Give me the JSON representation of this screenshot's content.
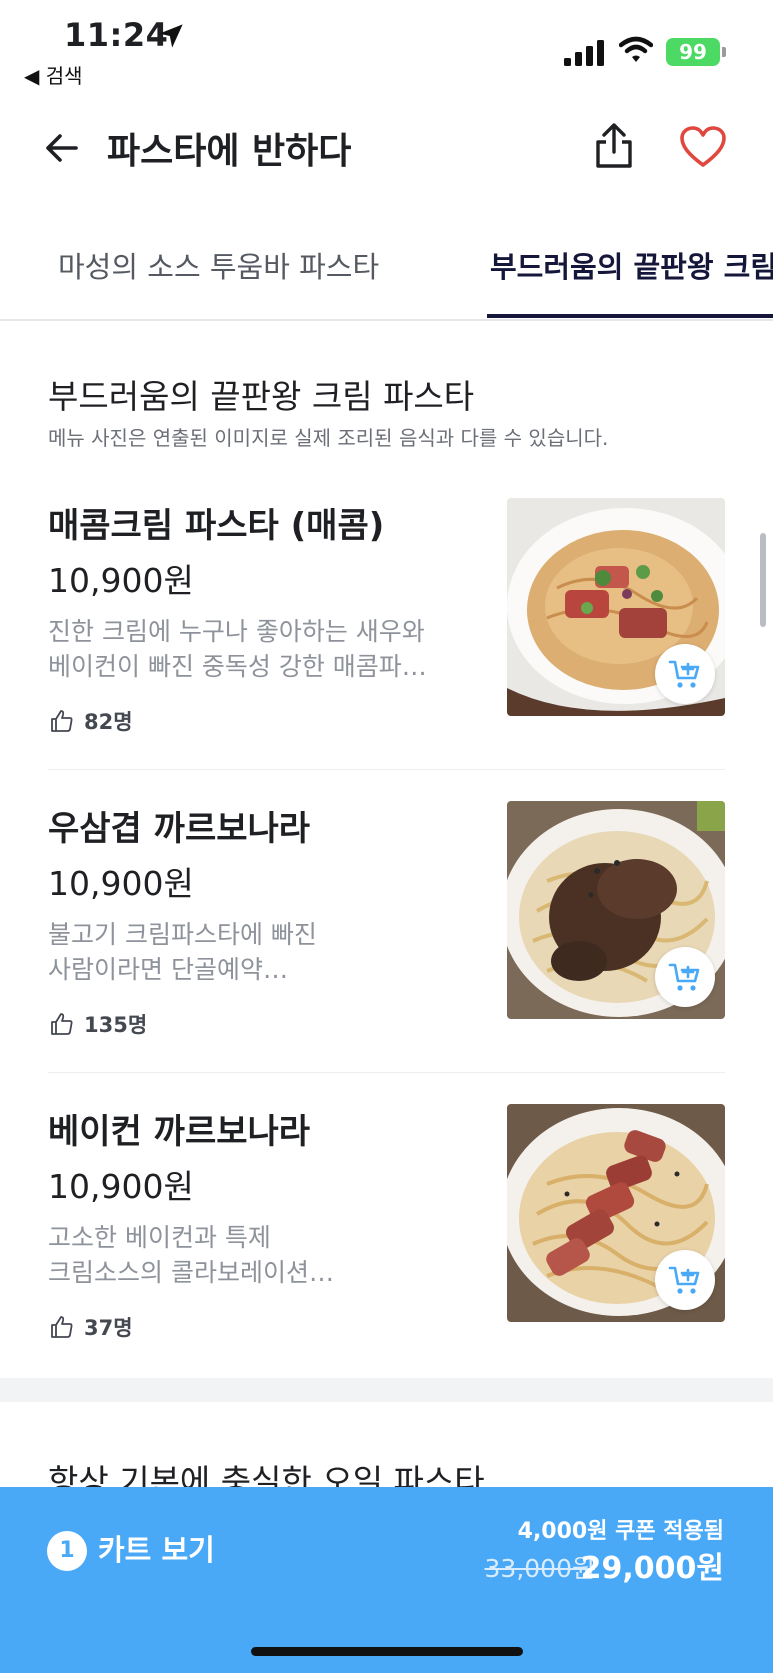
{
  "status_bar": {
    "time": "11:24",
    "back_app": "◀ 검색",
    "battery": "99"
  },
  "header": {
    "title": "파스타에 반하다"
  },
  "tabs": [
    {
      "label": "마성의 소스 투움바 파스타",
      "active": false
    },
    {
      "label": "부드러움의 끝판왕 크림",
      "active": true
    }
  ],
  "section": {
    "title": "부드러움의 끝판왕 크림 파스타",
    "notice": "메뉴 사진은 연출된 이미지로 실제 조리된 음식과 다를 수 있습니다."
  },
  "menu_items": [
    {
      "name": "매콤크림 파스타 (매콤)",
      "price": "10,900원",
      "desc1": "진한 크림에 누구나 좋아하는 새우와",
      "desc2": "베이컨이 빠진 중독성 강한 매콤파…",
      "likes": "82명"
    },
    {
      "name": "우삼겹 까르보나라",
      "price": "10,900원",
      "desc1": "불고기 크림파스타에 빠진",
      "desc2": "사람이라면 단골예약…",
      "likes": "135명"
    },
    {
      "name": "베이컨 까르보나라",
      "price": "10,900원",
      "desc1": "고소한 베이컨과 특제",
      "desc2": "크림소스의 콜라보레이션…",
      "likes": "37명"
    }
  ],
  "next_section": {
    "title": "항상 기본에 충실한 오일 파스타"
  },
  "cart": {
    "count": "1",
    "label": "카트 보기",
    "coupon": "4,000원 쿠폰 적용됨",
    "original_price": "33,000원",
    "final_price": "29,000원"
  },
  "colors": {
    "accent": "#4aa9f7",
    "heart": "#e0473e",
    "tab_active": "#14163a"
  }
}
